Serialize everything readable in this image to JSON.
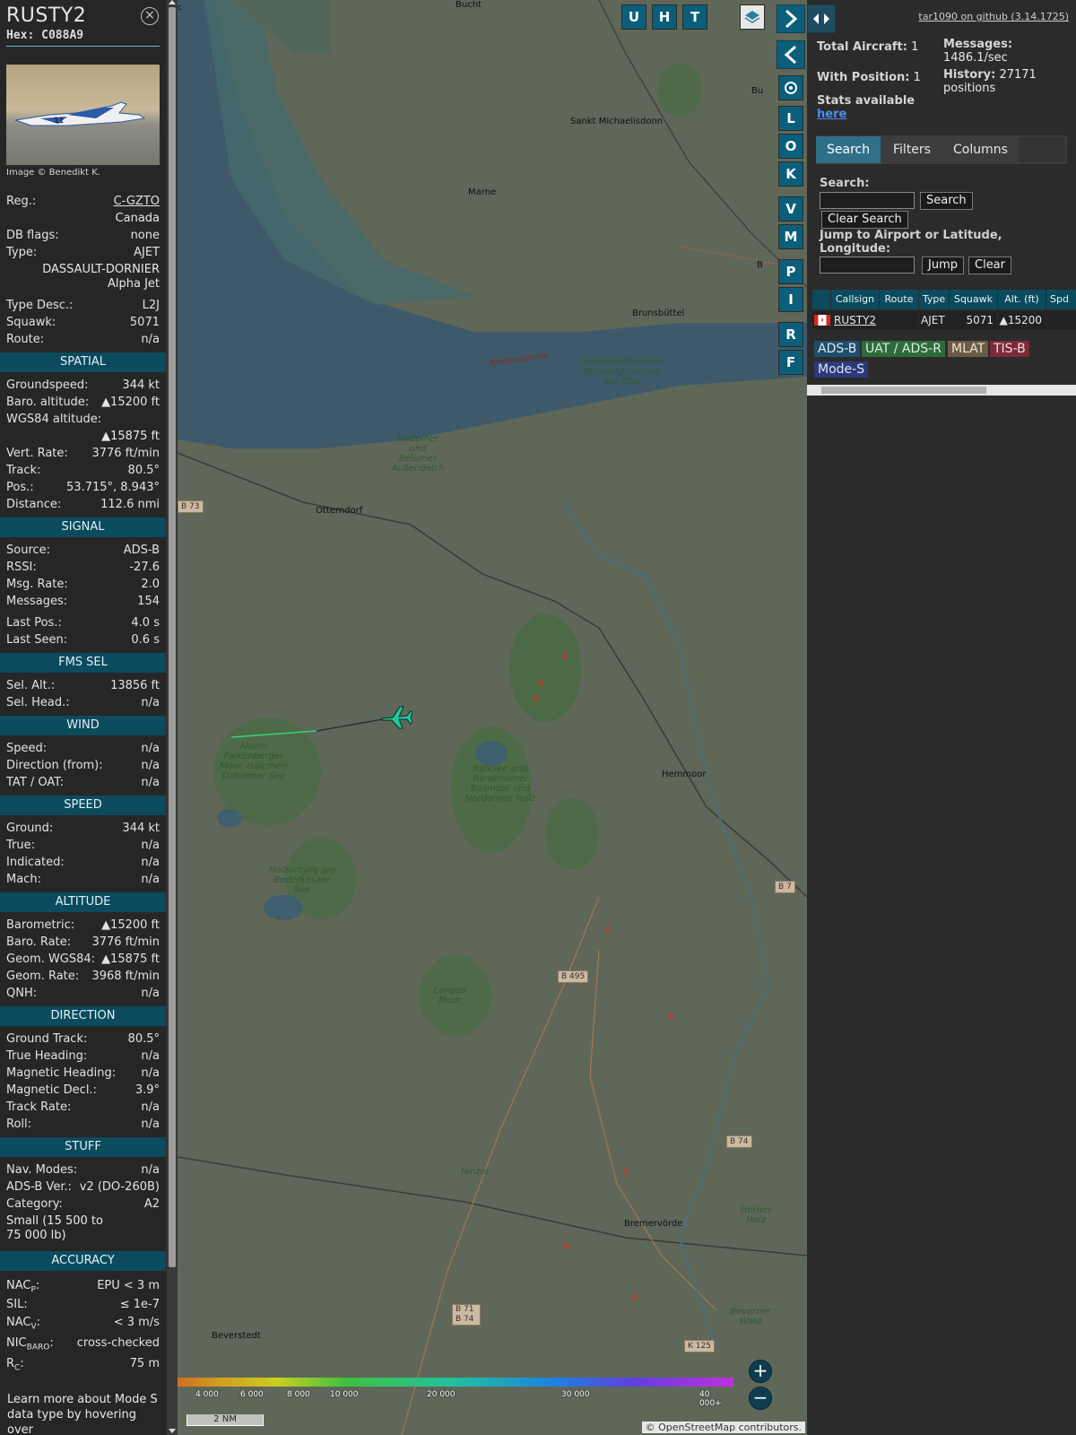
{
  "aircraft": {
    "callsign": "RUSTY2",
    "hex_label": "Hex:",
    "hex": "C088A9",
    "image_credit": "Image © Benedikt K.",
    "reg_label": "Reg.:",
    "reg": "C-GZTO",
    "country": "Canada",
    "dbflags_label": "DB flags:",
    "dbflags": "none",
    "type_label": "Type:",
    "type": "AJET",
    "type_name": "DASSAULT-DORNIER Alpha Jet",
    "typedesc_label": "Type Desc.:",
    "typedesc": "L2J",
    "squawk_label": "Squawk:",
    "squawk": "5071",
    "route_label": "Route:",
    "route": "n/a"
  },
  "sections": {
    "spatial": "SPATIAL",
    "signal": "SIGNAL",
    "fms": "FMS SEL",
    "wind": "WIND",
    "speed": "SPEED",
    "altitude": "ALTITUDE",
    "direction": "DIRECTION",
    "stuff": "STUFF",
    "accuracy": "ACCURACY"
  },
  "spatial": [
    {
      "l": "Groundspeed:",
      "v": "344 kt"
    },
    {
      "l": "Baro. altitude:",
      "v": "▲15200 ft"
    }
  ],
  "spatial_wgs": {
    "l": "WGS84 altitude:",
    "v": "▲15875 ft"
  },
  "spatial2": [
    {
      "l": "Vert. Rate:",
      "v": "3776 ft/min"
    },
    {
      "l": "Track:",
      "v": "80.5°"
    },
    {
      "l": "Pos.:",
      "v": "53.715°, 8.943°"
    },
    {
      "l": "Distance:",
      "v": "112.6 nmi"
    }
  ],
  "signal": [
    {
      "l": "Source:",
      "v": "ADS-B"
    },
    {
      "l": "RSSI:",
      "v": "-27.6"
    },
    {
      "l": "Msg. Rate:",
      "v": "2.0"
    },
    {
      "l": "Messages:",
      "v": "154"
    }
  ],
  "signal2": [
    {
      "l": "Last Pos.:",
      "v": "4.0 s"
    },
    {
      "l": "Last Seen:",
      "v": "0.6 s"
    }
  ],
  "fms": [
    {
      "l": "Sel. Alt.:",
      "v": "13856 ft"
    },
    {
      "l": "Sel. Head.:",
      "v": "n/a"
    }
  ],
  "wind": [
    {
      "l": "Speed:",
      "v": "n/a"
    },
    {
      "l": "Direction (from):",
      "v": "n/a"
    },
    {
      "l": "TAT / OAT:",
      "v": "n/a"
    }
  ],
  "speed": [
    {
      "l": "Ground:",
      "v": "344 kt"
    },
    {
      "l": "True:",
      "v": "n/a"
    },
    {
      "l": "Indicated:",
      "v": "n/a"
    },
    {
      "l": "Mach:",
      "v": "n/a"
    }
  ],
  "altitude": [
    {
      "l": "Barometric:",
      "v": "▲15200 ft"
    },
    {
      "l": "Baro. Rate:",
      "v": "3776 ft/min"
    },
    {
      "l": "Geom. WGS84:",
      "v": "▲15875 ft"
    },
    {
      "l": "Geom. Rate:",
      "v": "3968 ft/min"
    },
    {
      "l": "QNH:",
      "v": "n/a"
    }
  ],
  "direction": [
    {
      "l": "Ground Track:",
      "v": "80.5°"
    },
    {
      "l": "True Heading:",
      "v": "n/a"
    },
    {
      "l": "Magnetic Heading:",
      "v": "n/a"
    },
    {
      "l": "Magnetic Decl.:",
      "v": "3.9°"
    },
    {
      "l": "Track Rate:",
      "v": "n/a"
    },
    {
      "l": "Roll:",
      "v": "n/a"
    }
  ],
  "stuff": [
    {
      "l": "Nav. Modes:",
      "v": "n/a"
    },
    {
      "l": "ADS-B Ver.:",
      "v": "v2 (DO-260B)"
    },
    {
      "l": "Category:",
      "v": "A2"
    }
  ],
  "stuff_category_desc": "Small (15 500 to 75 000 lb)",
  "accuracy": {
    "nacp_l": "NAC",
    "nacp_sub": "P",
    "nacp_v": "EPU < 3 m",
    "sil_l": "SIL:",
    "sil_v": "≤ 1e-7",
    "nacv_l": "NAC",
    "nacv_sub": "V",
    "nacv_v": "< 3 m/s",
    "nic_l": "NIC",
    "nic_sub": "BARO",
    "nic_v": "cross-checked",
    "rc_l": "R",
    "rc_sub": "C",
    "rc_v": "75 m"
  },
  "learn_more": "Learn more about Mode S data type by hovering over",
  "map": {
    "labels": {
      "bucht": "Bucht",
      "sankt": "Sankt Michaelisdonn",
      "marne": "Marne",
      "brunsbuttel": "Brunsbüttel",
      "niedersachsen": "Niedersachsen",
      "mundungstrichter": "Niedersächsischer Mündungstrichter der Elbe",
      "hadelner": "Hadelner und Belumer Außendeich",
      "otterndorf": "Otterndorf",
      "hemmoor": "Hemmoor",
      "ahlen": "Ahlen-Falkenberger Moor, Halemer/ Dahlemer See",
      "balksee": "Balksee und Randmoore/ Basmoor und Nordahner Holz",
      "holzurburg": "Holzurburg am Bederkesaer See",
      "langes": "Langes Moor",
      "hinzel": "Hinzel",
      "bremervorde": "Bremervörde",
      "hornerholz": "Horner Holz",
      "beverstedt": "Beverstedt",
      "beverner": "Beverner Wald",
      "bu": "Bu",
      "b": "B",
      "c": "c"
    },
    "shields": {
      "b73": "B 73",
      "b495": "B 495",
      "b74": "B 74",
      "b71": "B 71",
      "b74b": "B 74",
      "k125": "K 125",
      "b7": "B 7"
    },
    "buttons": {
      "u": "U",
      "h": "H",
      "t": "T",
      "l": "L",
      "o": "O",
      "k": "K",
      "v": "V",
      "m": "M",
      "p": "P",
      "i": "I",
      "r": "R",
      "f": "F"
    },
    "zoom_in": "+",
    "zoom_out": "−",
    "altscale_ticks": [
      "4 000",
      "6 000",
      "8 000",
      "10 000",
      "20 000",
      "30 000",
      "40 000+"
    ],
    "scale_label": "2 NM",
    "attribution_prefix": "© ",
    "attribution_link": "OpenStreetMap",
    "attribution_suffix": " contributors."
  },
  "sidebar": {
    "github": "tar1090 on github (3.14.1725)",
    "total_label": "Total Aircraft:",
    "total": "1",
    "withpos_label": "With Position:",
    "withpos": "1",
    "stats_text": "Stats available",
    "stats_link": "here",
    "messages_label": "Messages:",
    "messages": "1486.1/sec",
    "history_label": "History:",
    "history": "27171 positions",
    "tabs": [
      "Search",
      "Filters",
      "Columns"
    ],
    "search_label": "Search:",
    "search_btn": "Search",
    "clear_search_btn": "Clear Search",
    "jump_label": "Jump to Airport or Latitude, Longitude:",
    "jump_btn": "Jump",
    "clear_btn": "Clear",
    "columns": [
      "Callsign",
      "Route",
      "Type",
      "Squawk",
      "Alt. (ft)",
      "Spd"
    ],
    "row": {
      "callsign": "RUSTY2",
      "route": "",
      "type": "AJET",
      "squawk": "5071",
      "alt": "▲15200",
      "spd": ""
    },
    "badges": [
      "ADS-B",
      "UAT / ADS-R",
      "MLAT",
      "TIS-B",
      "Mode-S"
    ]
  },
  "colors": {
    "section": "#0c4a5e",
    "accent": "#2f6f88",
    "adsb": "#1f4d6b",
    "uat": "#2e6b3a",
    "mlat": "#6b5a44",
    "tisb": "#7a2a3a",
    "modes": "#2a3a7a"
  }
}
